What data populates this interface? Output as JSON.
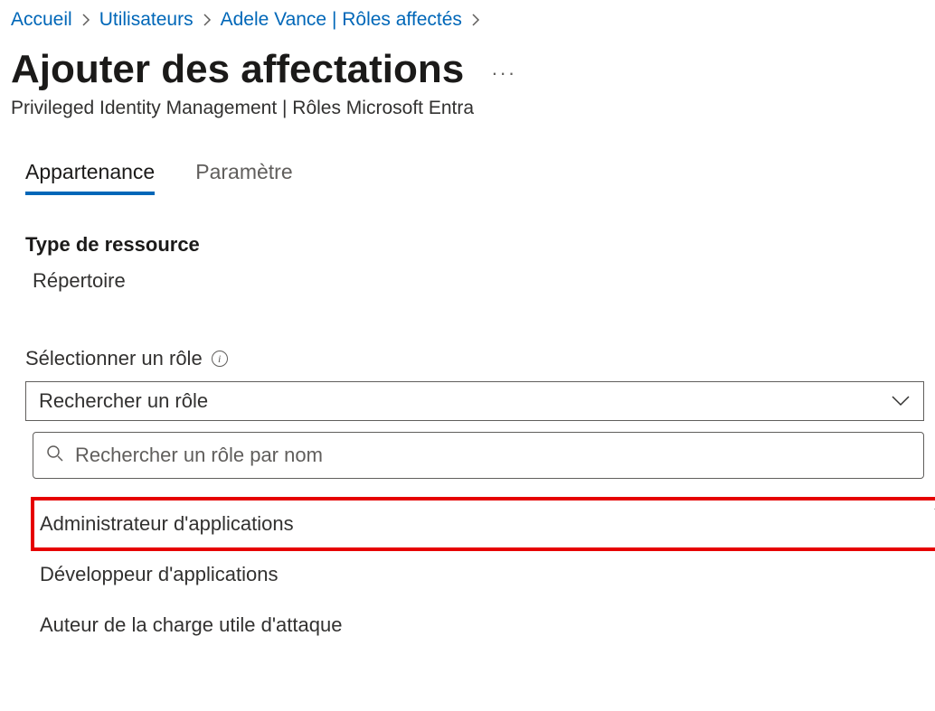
{
  "breadcrumb": {
    "items": [
      {
        "label": "Accueil"
      },
      {
        "label": "Utilisateurs"
      },
      {
        "label": "Adele Vance | Rôles affectés"
      }
    ]
  },
  "header": {
    "title": "Ajouter des affectations",
    "more_label": "···",
    "subtitle": "Privileged Identity Management | Rôles Microsoft Entra"
  },
  "tabs": {
    "items": [
      {
        "label": "Appartenance",
        "active": true
      },
      {
        "label": "Paramètre",
        "active": false
      }
    ]
  },
  "form": {
    "resource_type_label": "Type de ressource",
    "resource_type_value": "Répertoire",
    "select_role_label": "Sélectionner un rôle",
    "role_trigger_placeholder": "Rechercher un rôle",
    "search_placeholder": "Rechercher un rôle par nom",
    "options": [
      {
        "label": "Administrateur d'applications",
        "highlighted": true
      },
      {
        "label": "Développeur d'applications",
        "highlighted": false
      },
      {
        "label": "Auteur de la charge utile d'attaque",
        "highlighted": false
      }
    ]
  }
}
